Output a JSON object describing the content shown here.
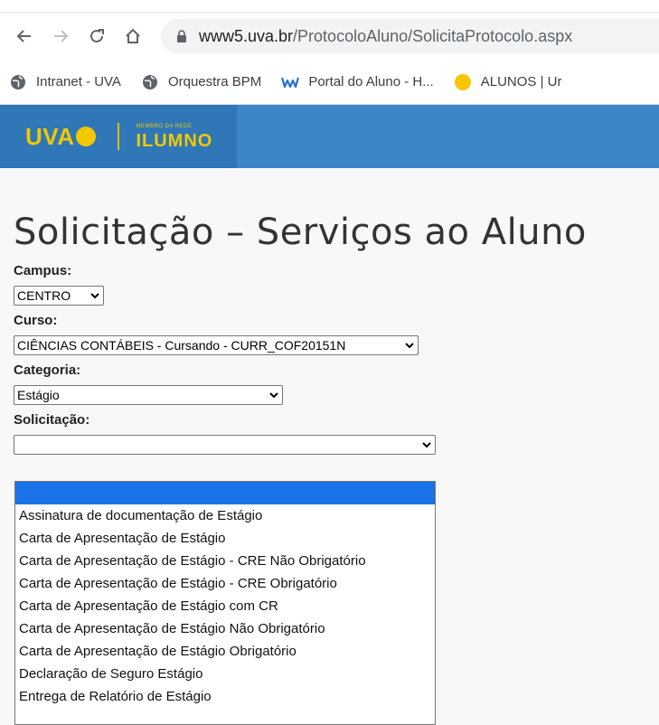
{
  "browser": {
    "url_host": "www5.uva.br",
    "url_path": "/ProtocoloAluno/SolicitaProtocolo.aspx",
    "bookmarks": [
      {
        "label": "Intranet - UVA",
        "icon": "globe-icon"
      },
      {
        "label": "Orquestra BPM",
        "icon": "globe-icon"
      },
      {
        "label": "Portal do Aluno - H...",
        "icon": "w-logo-icon"
      },
      {
        "label": "ALUNOS | Ur",
        "icon": "yellow-circle-icon"
      }
    ]
  },
  "header": {
    "logo_text": "UVA",
    "partner_small": "MEMBRO DA REDE",
    "partner_big": "ILUMNO",
    "color_bar": "#3b86c6",
    "color_brand": "#f2c800"
  },
  "form": {
    "title": "Solicitação – Serviços ao Aluno",
    "campus": {
      "label": "Campus:",
      "value": "CENTRO"
    },
    "curso": {
      "label": "Curso:",
      "value": "CIÊNCIAS CONTÁBEIS - Cursando - CURR_COF20151N"
    },
    "categoria": {
      "label": "Categoria:",
      "value": "Estágio"
    },
    "solicitacao": {
      "label": "Solicitação:",
      "value": "",
      "options": [
        "",
        "Assinatura de documentação de Estágio",
        "Carta de Apresentação de Estágio",
        "Carta de Apresentação de Estágio - CRE Não Obrigatório",
        "Carta de Apresentação de Estágio - CRE Obrigatório",
        "Carta de Apresentação de Estágio com CR",
        "Carta de Apresentação de Estágio Não Obrigatório",
        "Carta de Apresentação de Estágio Obrigatório",
        "Declaração de Seguro Estágio",
        "Entrega de Relatório de Estágio"
      ]
    }
  }
}
